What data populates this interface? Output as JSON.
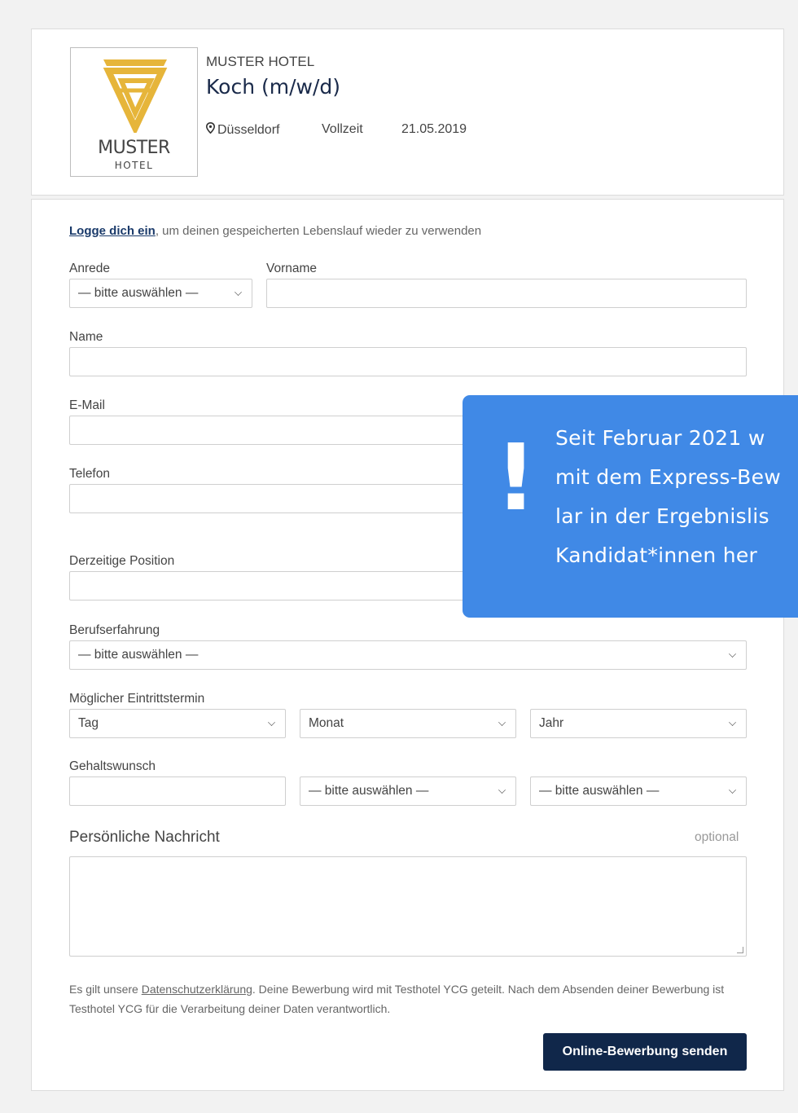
{
  "header": {
    "logo": {
      "name": "MUSTER",
      "sub": "HOTEL"
    },
    "company": "MUSTER HOTEL",
    "job_title": "Koch (m/w/d)",
    "location": "Düsseldorf",
    "employment_type": "Vollzeit",
    "date": "21.05.2019"
  },
  "form": {
    "login_link": "Logge dich ein",
    "login_text": ", um deinen gespeicherten Lebenslauf wieder zu verwenden",
    "anrede": {
      "label": "Anrede",
      "value": "— bitte auswählen —"
    },
    "vorname": {
      "label": "Vorname",
      "value": ""
    },
    "name": {
      "label": "Name",
      "value": ""
    },
    "email": {
      "label": "E-Mail",
      "value": ""
    },
    "telefon": {
      "label": "Telefon",
      "value": ""
    },
    "position": {
      "label": "Derzeitige Position",
      "value": ""
    },
    "berufserfahrung": {
      "label": "Berufserfahrung",
      "value": "— bitte auswählen —"
    },
    "eintritt": {
      "label": "Möglicher Eintrittstermin",
      "tag": "Tag",
      "monat": "Monat",
      "jahr": "Jahr"
    },
    "gehalt": {
      "label": "Gehaltswunsch",
      "amount": "",
      "select1": "— bitte auswählen —",
      "select2": "— bitte auswählen —"
    },
    "nachricht": {
      "label": "Persönliche Nachricht",
      "optional": "optional",
      "value": ""
    },
    "disclaimer": {
      "prefix": "Es gilt unsere ",
      "link": "Datenschutzerklärung",
      "suffix": ". Deine Bewerbung wird mit Testhotel YCG geteilt. Nach dem Absenden deiner Bewerbung ist Testhotel YCG für die Verarbeitung deiner Daten verantwortlich."
    },
    "submit_label": "Online-Bewerbung senden"
  },
  "overlay": {
    "mark": "!",
    "lines": [
      "Seit Februar 2021 w",
      "mit dem Express-Bew",
      "lar in der Ergebnislis",
      "Kandidat*innen her"
    ]
  },
  "colors": {
    "overlay_bg": "#4089e6",
    "submit_bg": "#10274a",
    "logo_gold": "#e6b53a"
  }
}
